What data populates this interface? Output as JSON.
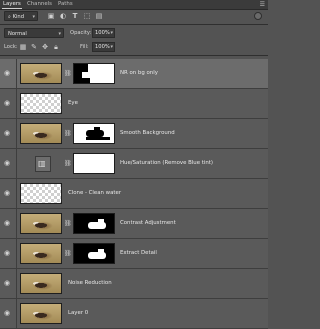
{
  "tabs": [
    {
      "label": "Layers",
      "active": true
    },
    {
      "label": "Channels",
      "active": false
    },
    {
      "label": "Paths",
      "active": false
    }
  ],
  "panel_menu_icon": "panel-menu-icon",
  "filter": {
    "kind_label": "Kind",
    "filter_icons": [
      "image-filter-icon",
      "adjustment-filter-icon",
      "type-filter-icon",
      "shape-filter-icon",
      "smart-object-filter-icon"
    ]
  },
  "blend": {
    "mode": "Normal",
    "opacity_label": "Opacity:",
    "opacity_value": "100%"
  },
  "lock": {
    "label": "Lock:",
    "fill_label": "Fill:",
    "fill_value": "100%",
    "lock_icons": [
      "lock-transparent-icon",
      "lock-paint-icon",
      "lock-position-icon",
      "lock-all-icon"
    ]
  },
  "layers": [
    {
      "name": "NR on bg only",
      "thumb": "photo",
      "mask": "nr-mask",
      "selected": true
    },
    {
      "name": "Eye",
      "thumb": "checker",
      "mask": null,
      "selected": false
    },
    {
      "name": "Smooth Background",
      "thumb": "photo",
      "mask": "smooth-mask",
      "selected": false
    },
    {
      "name": "Hue/Saturation (Remove Blue tint)",
      "thumb": "adjustment",
      "mask": "white",
      "selected": false
    },
    {
      "name": "Clone - Clean water",
      "thumb": "checker",
      "mask": null,
      "selected": false
    },
    {
      "name": "Contrast Adjustment",
      "thumb": "photo",
      "mask": "contrast-mask",
      "selected": false
    },
    {
      "name": "Extract Detail",
      "thumb": "photo",
      "mask": "detail-mask",
      "selected": false
    },
    {
      "name": "Noise Reduction",
      "thumb": "photo",
      "mask": null,
      "selected": false
    },
    {
      "name": "Layer 0",
      "thumb": "photo",
      "mask": null,
      "selected": false
    }
  ],
  "colors": {
    "panel_bg": "#535353",
    "selected_row": "#6c6c6c",
    "row_bg": "#5a5a5a"
  }
}
